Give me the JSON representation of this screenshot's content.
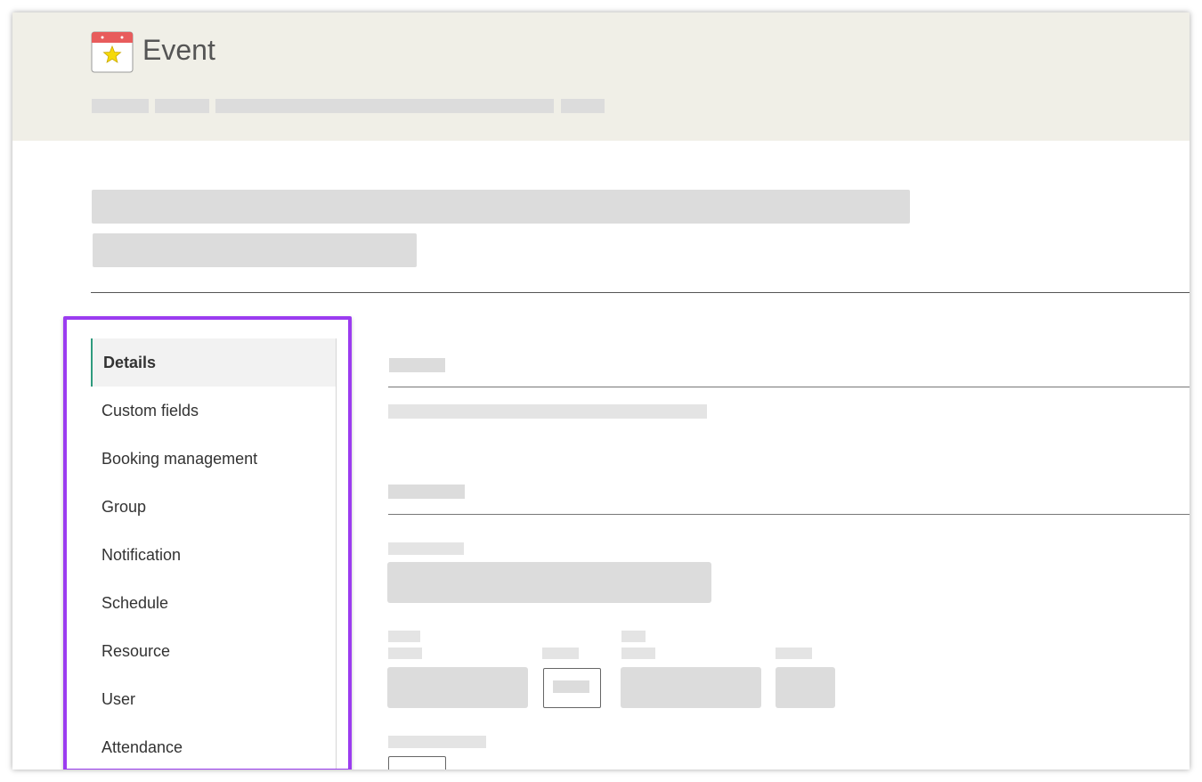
{
  "header": {
    "title": "Event",
    "icon": "calendar-star-icon"
  },
  "nav": {
    "items": [
      {
        "label": "Details",
        "active": true
      },
      {
        "label": "Custom fields",
        "active": false
      },
      {
        "label": "Booking management",
        "active": false
      },
      {
        "label": "Group",
        "active": false
      },
      {
        "label": "Notification",
        "active": false
      },
      {
        "label": "Schedule",
        "active": false
      },
      {
        "label": "Resource",
        "active": false
      },
      {
        "label": "User",
        "active": false
      },
      {
        "label": "Attendance",
        "active": false
      }
    ]
  },
  "colors": {
    "header_bg": "#f0efe7",
    "active_accent": "#2f9b7d",
    "highlight_border": "#9b3cf0"
  }
}
